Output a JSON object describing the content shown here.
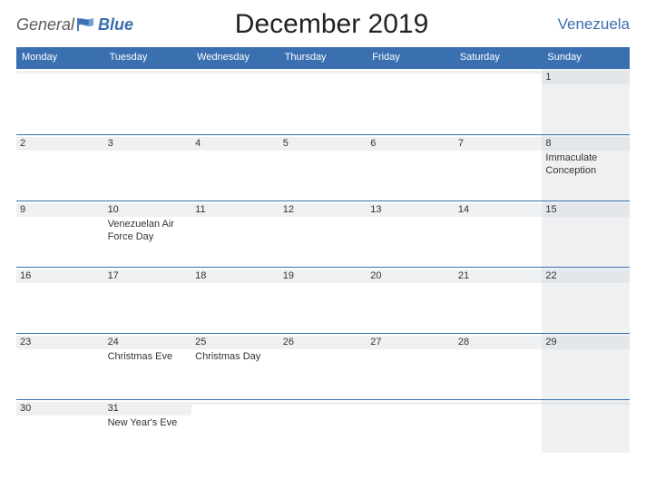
{
  "logo": {
    "text1": "General",
    "text2": "Blue"
  },
  "title": "December 2019",
  "country": "Venezuela",
  "day_headers": [
    "Monday",
    "Tuesday",
    "Wednesday",
    "Thursday",
    "Friday",
    "Saturday",
    "Sunday"
  ],
  "weeks": [
    [
      {
        "date": "",
        "event": ""
      },
      {
        "date": "",
        "event": ""
      },
      {
        "date": "",
        "event": ""
      },
      {
        "date": "",
        "event": ""
      },
      {
        "date": "",
        "event": ""
      },
      {
        "date": "",
        "event": ""
      },
      {
        "date": "1",
        "event": ""
      }
    ],
    [
      {
        "date": "2",
        "event": ""
      },
      {
        "date": "3",
        "event": ""
      },
      {
        "date": "4",
        "event": ""
      },
      {
        "date": "5",
        "event": ""
      },
      {
        "date": "6",
        "event": ""
      },
      {
        "date": "7",
        "event": ""
      },
      {
        "date": "8",
        "event": "Immaculate Conception"
      }
    ],
    [
      {
        "date": "9",
        "event": ""
      },
      {
        "date": "10",
        "event": "Venezuelan Air Force Day"
      },
      {
        "date": "11",
        "event": ""
      },
      {
        "date": "12",
        "event": ""
      },
      {
        "date": "13",
        "event": ""
      },
      {
        "date": "14",
        "event": ""
      },
      {
        "date": "15",
        "event": ""
      }
    ],
    [
      {
        "date": "16",
        "event": ""
      },
      {
        "date": "17",
        "event": ""
      },
      {
        "date": "18",
        "event": ""
      },
      {
        "date": "19",
        "event": ""
      },
      {
        "date": "20",
        "event": ""
      },
      {
        "date": "21",
        "event": ""
      },
      {
        "date": "22",
        "event": ""
      }
    ],
    [
      {
        "date": "23",
        "event": ""
      },
      {
        "date": "24",
        "event": "Christmas Eve"
      },
      {
        "date": "25",
        "event": "Christmas Day"
      },
      {
        "date": "26",
        "event": ""
      },
      {
        "date": "27",
        "event": ""
      },
      {
        "date": "28",
        "event": ""
      },
      {
        "date": "29",
        "event": ""
      }
    ],
    [
      {
        "date": "30",
        "event": ""
      },
      {
        "date": "31",
        "event": "New Year's Eve"
      },
      {
        "date": "",
        "event": ""
      },
      {
        "date": "",
        "event": ""
      },
      {
        "date": "",
        "event": ""
      },
      {
        "date": "",
        "event": ""
      },
      {
        "date": "",
        "event": ""
      }
    ]
  ]
}
